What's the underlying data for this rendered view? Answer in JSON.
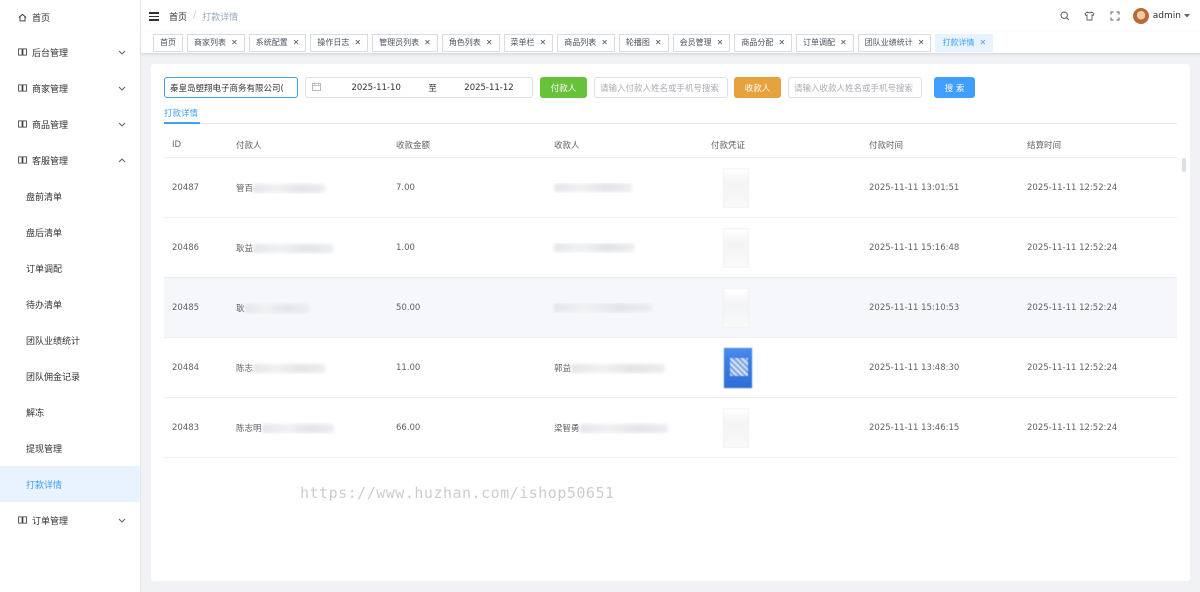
{
  "sidebar": {
    "items": [
      {
        "label": "首页",
        "icon": "home-icon",
        "expandable": false
      },
      {
        "label": "后台管理",
        "icon": "book-icon",
        "expandable": true,
        "expanded": false
      },
      {
        "label": "商家管理",
        "icon": "book-icon",
        "expandable": true,
        "expanded": false
      },
      {
        "label": "商品管理",
        "icon": "book-icon",
        "expandable": true,
        "expanded": false
      },
      {
        "label": "客服管理",
        "icon": "book-icon",
        "expandable": true,
        "expanded": true
      }
    ],
    "sub_items": [
      "盘前清单",
      "盘后清单",
      "订单调配",
      "待办清单",
      "团队业绩统计",
      "团队佣金记录",
      "解冻",
      "提现管理",
      "打款详情"
    ],
    "active_sub": "打款详情",
    "last_item": {
      "label": "订单管理",
      "icon": "book-icon",
      "expandable": true
    }
  },
  "navbar": {
    "breadcrumb": [
      "首页",
      "打款详情"
    ],
    "user": "admin"
  },
  "tags": [
    {
      "label": "首页",
      "closable": false
    },
    {
      "label": "商家列表",
      "closable": true
    },
    {
      "label": "系统配置",
      "closable": true
    },
    {
      "label": "操作日志",
      "closable": true
    },
    {
      "label": "管理员列表",
      "closable": true
    },
    {
      "label": "角色列表",
      "closable": true
    },
    {
      "label": "菜单栏",
      "closable": true
    },
    {
      "label": "商品列表",
      "closable": true
    },
    {
      "label": "轮播图",
      "closable": true
    },
    {
      "label": "会员管理",
      "closable": true
    },
    {
      "label": "商品分配",
      "closable": true
    },
    {
      "label": "订单调配",
      "closable": true
    },
    {
      "label": "团队业绩统计",
      "closable": true
    },
    {
      "label": "打款详情",
      "closable": true,
      "active": true
    }
  ],
  "filters": {
    "company": "秦皇岛塑翔电子商务有限公司(",
    "date_start": "2025-11-10",
    "date_sep": "至",
    "date_end": "2025-11-12",
    "payer_button": "付款人",
    "payer_placeholder": "请输入付款人姓名或手机号搜索",
    "payee_button": "收款人",
    "payee_placeholder": "请输入收款人姓名或手机号搜索",
    "search_button": "搜 索"
  },
  "subtab": "打款详情",
  "table": {
    "columns": [
      "ID",
      "付款人",
      "收款金额",
      "收款人",
      "付款凭证",
      "付款时间",
      "结算时间"
    ],
    "rows": [
      {
        "id": "20487",
        "payer": "管百",
        "amount": "7.00",
        "payee": "",
        "pay_time": "2025-11-11 13:01:51",
        "settle_time": "2025-11-11 12:52:24",
        "voucher": "white"
      },
      {
        "id": "20486",
        "payer": "耿益",
        "amount": "1.00",
        "payee": "",
        "pay_time": "2025-11-11 15:16:48",
        "settle_time": "2025-11-11 12:52:24",
        "voucher": "white"
      },
      {
        "id": "20485",
        "payer": "耿",
        "amount": "50.00",
        "payee": "",
        "pay_time": "2025-11-11 15:10:53",
        "settle_time": "2025-11-11 12:52:24",
        "voucher": "white"
      },
      {
        "id": "20484",
        "payer": "陈志",
        "amount": "11.00",
        "payee": "郭益",
        "pay_time": "2025-11-11 13:48:30",
        "settle_time": "2025-11-11 12:52:24",
        "voucher": "blue"
      },
      {
        "id": "20483",
        "payer": "陈志明",
        "amount": "66.00",
        "payee": "梁智勇",
        "pay_time": "2025-11-11 13:46:15",
        "settle_time": "2025-11-11 12:52:24",
        "voucher": "white"
      }
    ]
  },
  "watermark": "https://www.huzhan.com/ishop50651",
  "colors": {
    "accent": "#409eff",
    "green": "#67c23a",
    "orange": "#e6a23c",
    "active_bg": "#e8f3ff"
  }
}
